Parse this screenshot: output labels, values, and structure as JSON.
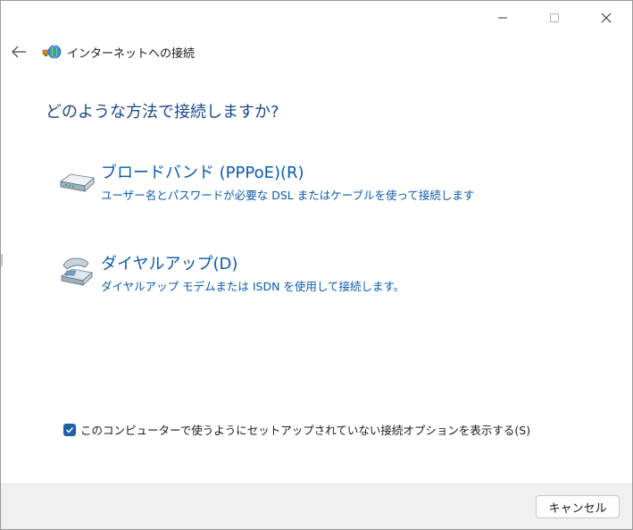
{
  "window": {
    "title": "インターネットへの接続"
  },
  "icons": {
    "back": "back-arrow-icon",
    "header": "network-globe-icon",
    "broadband": "modem-icon",
    "dialup": "telephone-modem-icon",
    "minimize": "minimize-icon",
    "maximize": "maximize-icon",
    "close": "close-icon",
    "checkmark": "checkmark-icon"
  },
  "main": {
    "question": "どのような方法で接続しますか?",
    "options": [
      {
        "title": "ブロードバンド (PPPoE)(R)",
        "description": "ユーザー名とパスワードが必要な DSL またはケーブルを使って接続します"
      },
      {
        "title": "ダイヤルアップ(D)",
        "description": "ダイヤルアップ モデムまたは ISDN を使用して接続します。"
      }
    ],
    "show_options_checkbox": {
      "label": "このコンピューターで使うようにセットアップされていない接続オプションを表示する(S)",
      "checked": true
    }
  },
  "footer": {
    "cancel_label": "キャンセル"
  },
  "colors": {
    "question": "#1a4a8a",
    "option_link": "#0a5bb0",
    "checkbox": "#1f5fa8",
    "footer_bg": "#f0f0f0"
  }
}
